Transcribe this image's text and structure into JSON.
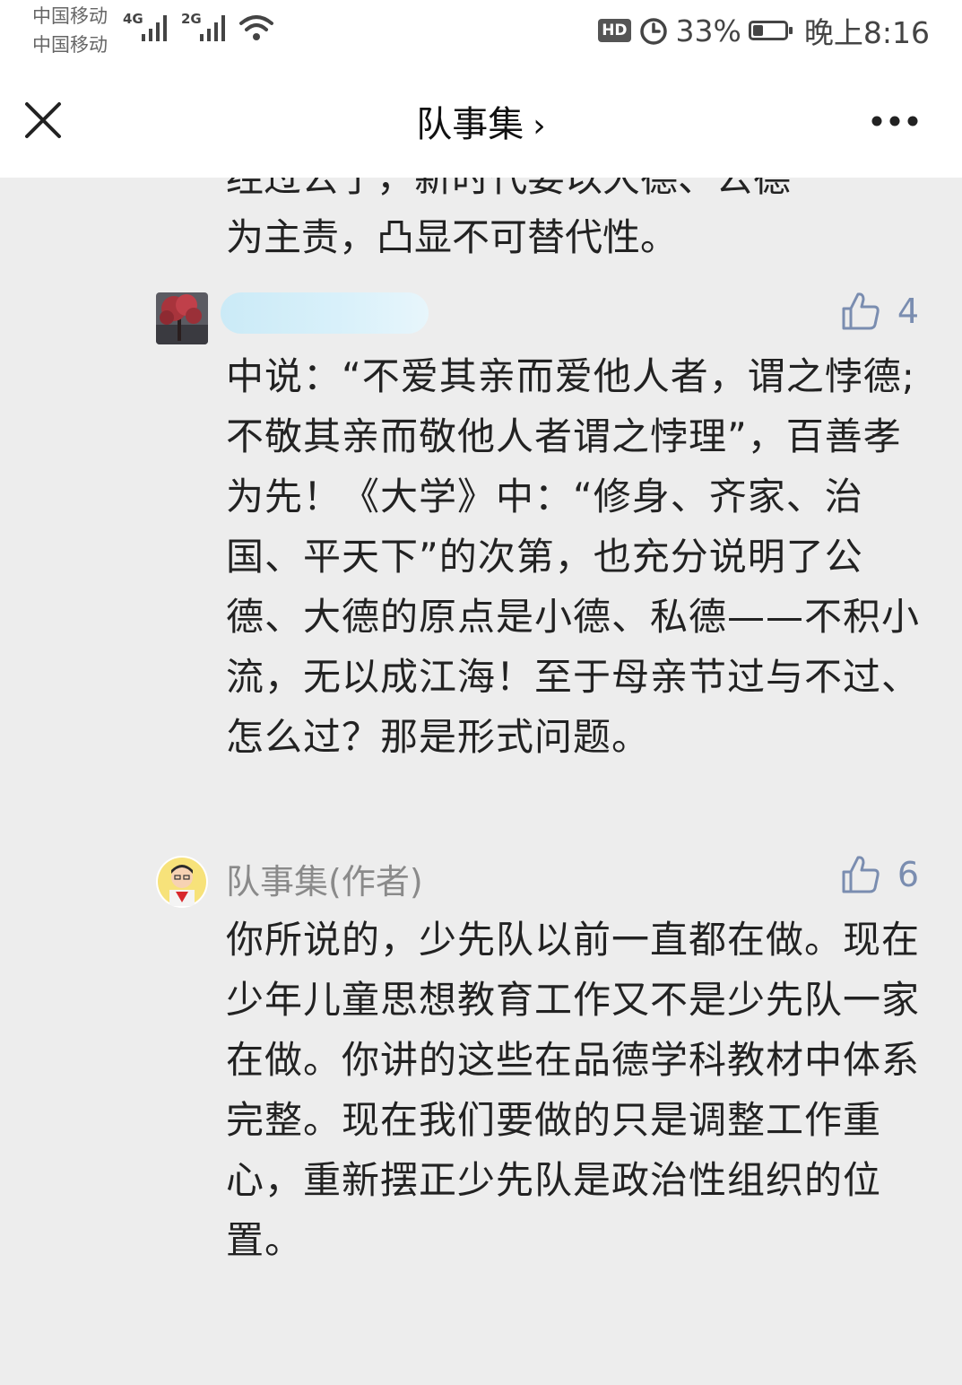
{
  "status_bar": {
    "carrier_1": "中国移动",
    "carrier_2": "中国移动",
    "network_1": "4G",
    "network_2": "2G",
    "hd": "HD",
    "battery_text": "33%",
    "battery_level": 0.33,
    "time": "晚上8:16"
  },
  "nav": {
    "title": "队事集",
    "chevron": "›"
  },
  "previous_comment": {
    "cut_line": "经过公了，新时代要以大德、公德",
    "last_line": "为主责，凸显不可替代性。"
  },
  "comments": [
    {
      "author": "",
      "likes": "4",
      "text": "中说：“不爱其亲而爱他人者，谓之悖德;不敬其亲而敬他人者谓之悖理”，百善孝为先！《大学》中：“修身、齐家、治国、平天下”的次第，也充分说明了公德、大德的原点是小德、私德——不积小流，无以成江海！至于母亲节过与不过、怎么过？那是形式问题。"
    },
    {
      "author": "队事集(作者)",
      "likes": "6",
      "text": "你所说的，少先队以前一直都在做。现在少年儿童思想教育工作又不是少先队一家在做。你讲的这些在品德学科教材中体系完整。现在我们要做的只是调整工作重心，重新摆正少先队是政治性组织的位置。"
    }
  ],
  "icons": {
    "close": "close-icon",
    "more": "more-icon",
    "like": "thumbs-up-icon",
    "alarm": "alarm-icon",
    "wifi": "wifi-icon",
    "signal": "signal-icon",
    "battery": "battery-icon"
  },
  "colors": {
    "background": "#ededed",
    "like": "#7a8db0",
    "author": "#8a8a8a"
  }
}
